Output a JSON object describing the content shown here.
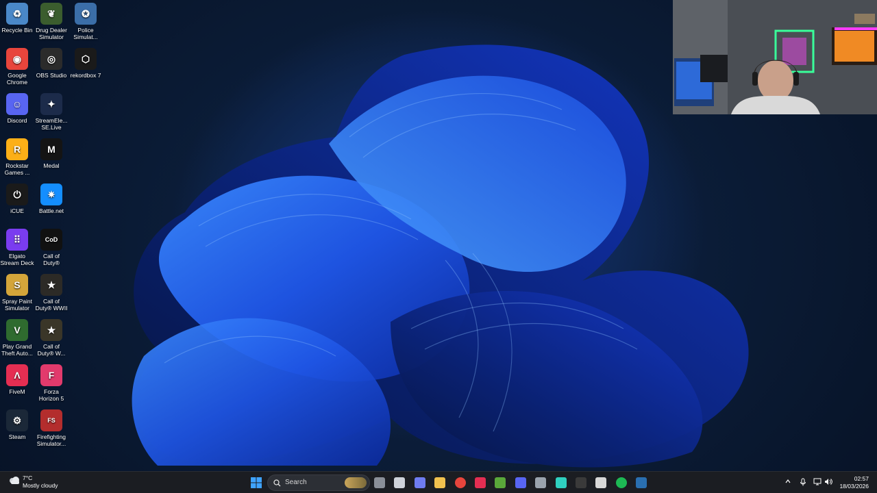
{
  "desktop": {
    "icons": [
      {
        "label": "Recycle Bin",
        "icon": "recycle-bin-icon",
        "color": "#4a88c8"
      },
      {
        "label": "Drug Dealer Simulator",
        "icon": "drug-dealer-simulator-icon",
        "color": "#3b5d2e"
      },
      {
        "label": "Police Simulat...",
        "icon": "police-simulator-icon",
        "color": "#3b6ea8"
      },
      {
        "label": "Google Chrome",
        "icon": "chrome-icon",
        "color": "#e8453c"
      },
      {
        "label": "OBS Studio",
        "icon": "obs-icon",
        "color": "#2b2b2b"
      },
      {
        "label": "rekordbox 7",
        "icon": "rekordbox-icon",
        "color": "#1a1a1a"
      },
      {
        "label": "Discord",
        "icon": "discord-icon",
        "color": "#5865f2"
      },
      {
        "label": "StreamEle... SE.Live",
        "icon": "streamelements-icon",
        "color": "#1c2b4a"
      },
      {
        "label": "Rockstar Games ...",
        "icon": "rockstar-icon",
        "color": "#fcaf17"
      },
      {
        "label": "Medal",
        "icon": "medal-icon",
        "color": "#141414"
      },
      {
        "label": "iCUE",
        "icon": "icue-icon",
        "color": "#1a1a1a"
      },
      {
        "label": "Battle.net",
        "icon": "battlenet-icon",
        "color": "#148eff"
      },
      {
        "label": "Elgato Stream Deck",
        "icon": "stream-deck-icon",
        "color": "#7a3cf0"
      },
      {
        "label": "Call of Duty®",
        "icon": "call-of-duty-icon",
        "color": "#111111"
      },
      {
        "label": "Spray Paint Simulator",
        "icon": "spray-paint-simulator-icon",
        "color": "#d4a53a"
      },
      {
        "label": "Call of Duty® WWII",
        "icon": "cod-wwii-icon",
        "color": "#2c2a26"
      },
      {
        "label": "Play Grand Theft Auto...",
        "icon": "gta-icon",
        "color": "#2f6b2f"
      },
      {
        "label": "Call of Duty® W...",
        "icon": "cod-ww-icon",
        "color": "#3a3628"
      },
      {
        "label": "FiveM",
        "icon": "fivem-icon",
        "color": "#e52e52"
      },
      {
        "label": "Forza Horizon 5",
        "icon": "forza-icon",
        "color": "#e23a6c"
      },
      {
        "label": "Steam",
        "icon": "steam-icon",
        "color": "#1b2838"
      },
      {
        "label": "Firefighting Simulator...",
        "icon": "firefighting-simulator-icon",
        "color": "#b32d2d"
      }
    ]
  },
  "taskbar": {
    "weather": {
      "temp": "7°C",
      "condition": "Mostly cloudy"
    },
    "search_label": "Search",
    "apps": [
      "widgets-icon",
      "task-view-icon",
      "chat-icon",
      "file-explorer-icon",
      "chrome-icon",
      "fivem-icon",
      "minecraft-icon",
      "discord-icon",
      "settings-icon",
      "stream-deck-icon",
      "obs-icon",
      "store-icon",
      "spotify-icon",
      "steam-icon"
    ],
    "clock": {
      "time": "02:57",
      "date": "18/03/2026"
    }
  },
  "colors": {
    "accent": "#2563eb",
    "taskbar": "#1b1d22",
    "desktop": "#0a1a33"
  }
}
